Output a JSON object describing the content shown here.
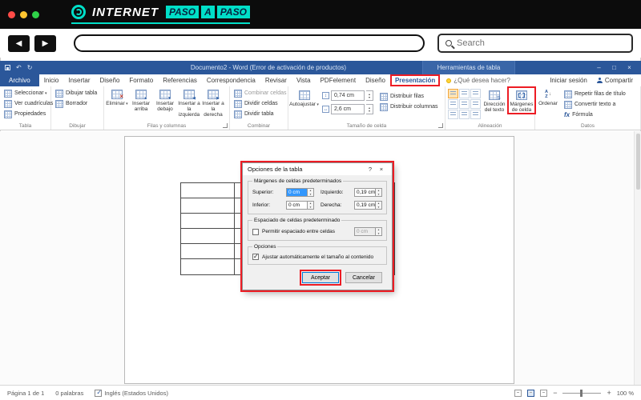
{
  "site_header": {
    "brand_internet": "INTERNET",
    "brand_paso1": "PASO",
    "brand_a": "A",
    "brand_paso2": "PASO"
  },
  "browser": {
    "search_placeholder": "Search"
  },
  "icons": {
    "back": "◀",
    "forward": "▶",
    "undo": "↶",
    "redo": "↻",
    "minimize": "–",
    "maximize": "□",
    "close": "×",
    "dialog_help": "?",
    "dialog_close": "×",
    "sort_a": "A",
    "sort_z": "Z",
    "sort_arrow": "↓",
    "formula": "fx",
    "zoom_out": "−",
    "zoom_in": "+"
  },
  "colors": {
    "word_blue": "#2b579a",
    "annotation_red": "#ed1c24",
    "brand_teal": "#00dfc8",
    "selection_blue": "#3297fd"
  },
  "word": {
    "titlebar": {
      "title": "Documento2 - Word (Error de activación de productos)",
      "context_header": "Herramientas de tabla",
      "help_tab": "¿Qué desea hacer?",
      "sign_in": "Iniciar sesión",
      "share": "Compartir"
    },
    "tabs": [
      "Archivo",
      "Inicio",
      "Insertar",
      "Diseño",
      "Formato",
      "Referencias",
      "Correspondencia",
      "Revisar",
      "Vista",
      "PDFelement",
      "Diseño",
      "Presentación"
    ],
    "ribbon": {
      "tabla": {
        "label": "Tabla",
        "items": [
          "Seleccionar",
          "Ver cuadrículas",
          "Propiedades"
        ]
      },
      "dibujar": {
        "label": "Dibujar",
        "items": [
          "Dibujar tabla",
          "Borrador"
        ]
      },
      "filas": {
        "label": "Filas y columnas",
        "items": [
          "Eliminar",
          "Insertar arriba",
          "Insertar debajo",
          "Insertar a la izquierda",
          "Insertar a la derecha"
        ]
      },
      "combinar": {
        "label": "Combinar",
        "items": [
          "Combinar celdas",
          "Dividir celdas",
          "Dividir tabla"
        ]
      },
      "tamano": {
        "label": "Tamaño de celda",
        "autofit": "Autoajustar",
        "height_value": "0,74 cm",
        "width_value": "2,6 cm",
        "items": [
          "Distribuir filas",
          "Distribuir columnas"
        ]
      },
      "alineacion": {
        "label": "Alineación",
        "items": [
          "Dirección del texto",
          "Márgenes de celda"
        ]
      },
      "datos": {
        "label": "Datos",
        "sort": "Ordenar",
        "items": [
          "Repetir filas de título",
          "Convertir texto a",
          "Fórmula"
        ]
      }
    },
    "dialog": {
      "title": "Opciones de la tabla",
      "margins_section": "Márgenes de celdas predeterminados",
      "fields": [
        {
          "label": "Superior:",
          "value": "0 cm"
        },
        {
          "label": "Izquierdo:",
          "value": "0,19 cm"
        },
        {
          "label": "Inferior:",
          "value": "0 cm"
        },
        {
          "label": "Derecha:",
          "value": "0,19 cm"
        }
      ],
      "spacing_section": "Espaciado de celdas predeterminado",
      "spacing_checkbox": "Permitir espaciado entre celdas",
      "spacing_value": "0 cm",
      "options_section": "Opciones",
      "autofit_checkbox": "Ajustar automáticamente el tamaño al contenido",
      "ok": "Aceptar",
      "cancel": "Cancelar"
    },
    "status": {
      "page": "Página 1 de 1",
      "words": "0 palabras",
      "language": "Inglés (Estados Unidos)",
      "zoom": "100 %"
    }
  }
}
